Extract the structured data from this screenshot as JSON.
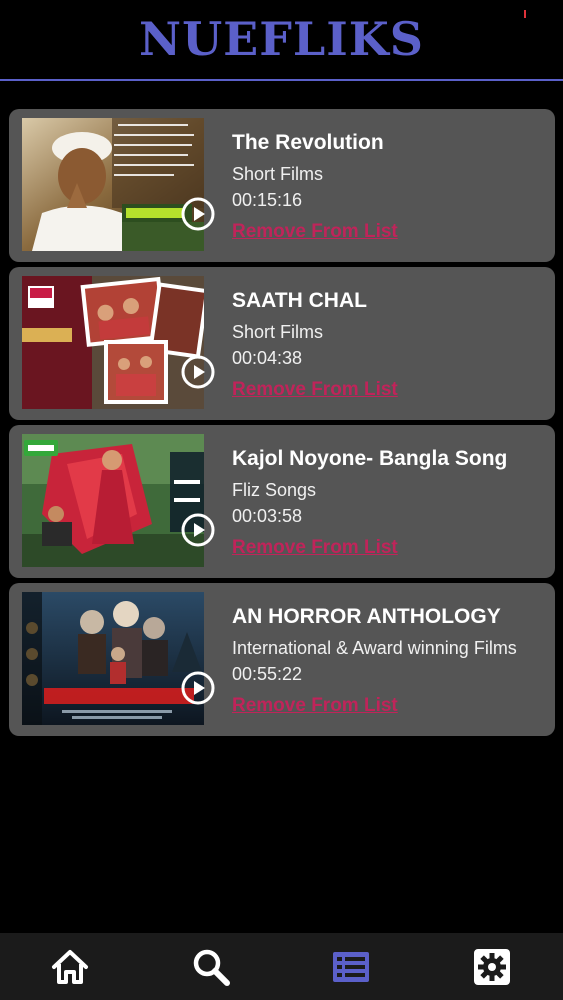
{
  "app": {
    "title": "NUEFLIKS"
  },
  "colors": {
    "brand": "#5b60c9",
    "card_bg": "#555555",
    "remove_link": "#c0245a",
    "tab_active": "#5b60c9",
    "tab_inactive": "#ffffff"
  },
  "playlist": {
    "items": [
      {
        "title": "The Revolution",
        "category": "Short Films",
        "duration": "00:15:16",
        "remove_label": "Remove From List"
      },
      {
        "title": "SAATH CHAL",
        "category": "Short Films",
        "duration": "00:04:38",
        "remove_label": "Remove From List"
      },
      {
        "title": "Kajol Noyone- Bangla Song",
        "category": "Fliz Songs",
        "duration": "00:03:58",
        "remove_label": "Remove From List"
      },
      {
        "title": "AN HORROR ANTHOLOGY",
        "category": "International & Award winning Films",
        "duration": "00:55:22",
        "remove_label": "Remove From List"
      }
    ]
  },
  "tabbar": {
    "tabs": [
      {
        "icon": "home-icon",
        "active": false
      },
      {
        "icon": "search-icon",
        "active": false
      },
      {
        "icon": "list-icon",
        "active": true
      },
      {
        "icon": "settings-icon",
        "active": false
      }
    ]
  }
}
